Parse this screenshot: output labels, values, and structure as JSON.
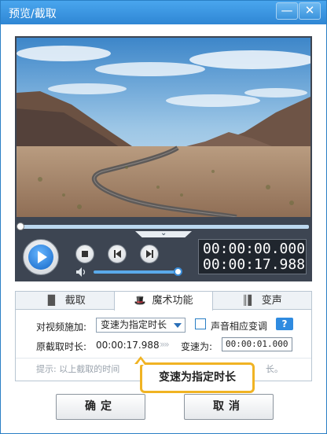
{
  "window": {
    "title": "预览/截取",
    "min_label": "—",
    "close_label": "✕"
  },
  "player": {
    "current_time": "00:00:00.000",
    "total_time": "00:00:17.988",
    "progress": 0.0,
    "volume": 0.95,
    "toggle_label": "⌄"
  },
  "tabs": [
    {
      "label": "截取",
      "icon": "crop-icon"
    },
    {
      "label": "魔术功能",
      "icon": "magic-icon"
    },
    {
      "label": "变声",
      "icon": "audio-wave-icon"
    }
  ],
  "magic": {
    "apply_label": "对视频施加:",
    "effect_value": "变速为指定时长",
    "sound_check_label": "声音相应变调",
    "help_label": "?",
    "orig_duration_label": "原截取时长:",
    "orig_duration_value": "00:00:17.988",
    "arrows": "»»",
    "speed_label": "变速为:",
    "speed_value": "00:00:01.000",
    "hint_left": "提示: 以上截取的时间",
    "hint_right": "长。"
  },
  "tooltip": {
    "text": "变速为指定时长"
  },
  "footer": {
    "ok_label": "确定",
    "cancel_label": "取消"
  },
  "colors": {
    "titlebar": "#3b93dc",
    "accent": "#2a7fc5",
    "highlight": "#f0b323"
  }
}
